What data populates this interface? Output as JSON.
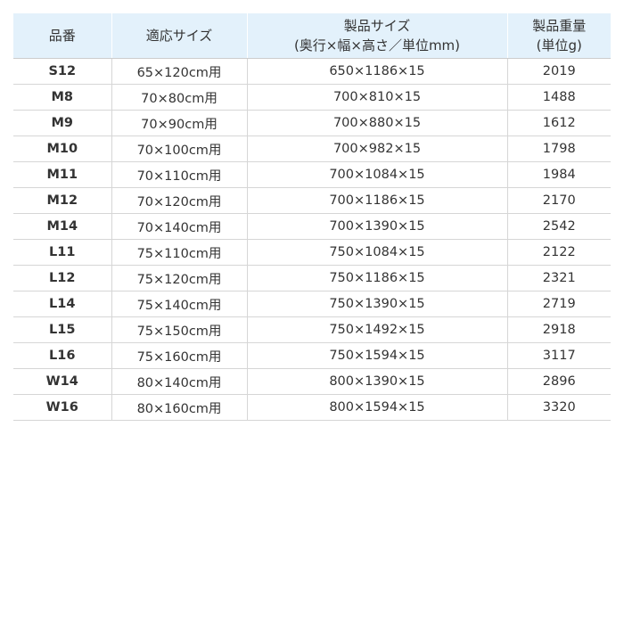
{
  "table": {
    "headers": {
      "code": "品番",
      "fit_size": "適応サイズ",
      "product_size_line1": "製品サイズ",
      "product_size_line2": "(奥行×幅×高さ／単位mm)",
      "weight_line1": "製品重量",
      "weight_line2": "(単位g)"
    },
    "rows": [
      {
        "code": "S12",
        "fit": "65×120cm用",
        "size": "650×1186×15",
        "weight": "2019"
      },
      {
        "code": "M8",
        "fit": "70×80cm用",
        "size": "700×810×15",
        "weight": "1488"
      },
      {
        "code": "M9",
        "fit": "70×90cm用",
        "size": "700×880×15",
        "weight": "1612"
      },
      {
        "code": "M10",
        "fit": "70×100cm用",
        "size": "700×982×15",
        "weight": "1798"
      },
      {
        "code": "M11",
        "fit": "70×110cm用",
        "size": "700×1084×15",
        "weight": "1984"
      },
      {
        "code": "M12",
        "fit": "70×120cm用",
        "size": "700×1186×15",
        "weight": "2170"
      },
      {
        "code": "M14",
        "fit": "70×140cm用",
        "size": "700×1390×15",
        "weight": "2542"
      },
      {
        "code": "L11",
        "fit": "75×110cm用",
        "size": "750×1084×15",
        "weight": "2122"
      },
      {
        "code": "L12",
        "fit": "75×120cm用",
        "size": "750×1186×15",
        "weight": "2321"
      },
      {
        "code": "L14",
        "fit": "75×140cm用",
        "size": "750×1390×15",
        "weight": "2719"
      },
      {
        "code": "L15",
        "fit": "75×150cm用",
        "size": "750×1492×15",
        "weight": "2918"
      },
      {
        "code": "L16",
        "fit": "75×160cm用",
        "size": "750×1594×15",
        "weight": "3117"
      },
      {
        "code": "W14",
        "fit": "80×140cm用",
        "size": "800×1390×15",
        "weight": "2896"
      },
      {
        "code": "W16",
        "fit": "80×160cm用",
        "size": "800×1594×15",
        "weight": "3320"
      }
    ]
  },
  "colors": {
    "header_background": "#e3f1fb",
    "text": "#333333",
    "row_divider": "#d6d6d6"
  }
}
